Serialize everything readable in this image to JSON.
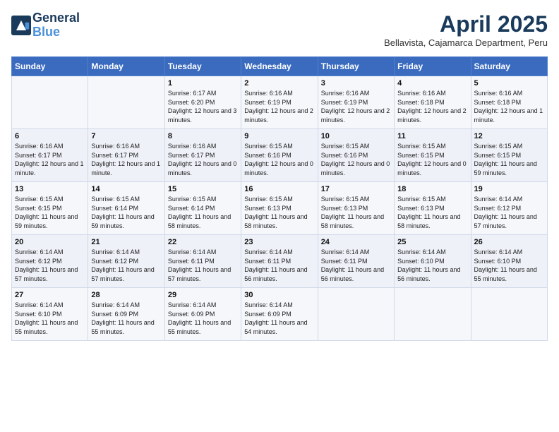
{
  "logo": {
    "line1": "General",
    "line2": "Blue"
  },
  "title": "April 2025",
  "location": "Bellavista, Cajamarca Department, Peru",
  "days_of_week": [
    "Sunday",
    "Monday",
    "Tuesday",
    "Wednesday",
    "Thursday",
    "Friday",
    "Saturday"
  ],
  "weeks": [
    [
      {
        "day": "",
        "info": ""
      },
      {
        "day": "",
        "info": ""
      },
      {
        "day": "1",
        "info": "Sunrise: 6:17 AM\nSunset: 6:20 PM\nDaylight: 12 hours and 3 minutes."
      },
      {
        "day": "2",
        "info": "Sunrise: 6:16 AM\nSunset: 6:19 PM\nDaylight: 12 hours and 2 minutes."
      },
      {
        "day": "3",
        "info": "Sunrise: 6:16 AM\nSunset: 6:19 PM\nDaylight: 12 hours and 2 minutes."
      },
      {
        "day": "4",
        "info": "Sunrise: 6:16 AM\nSunset: 6:18 PM\nDaylight: 12 hours and 2 minutes."
      },
      {
        "day": "5",
        "info": "Sunrise: 6:16 AM\nSunset: 6:18 PM\nDaylight: 12 hours and 1 minute."
      }
    ],
    [
      {
        "day": "6",
        "info": "Sunrise: 6:16 AM\nSunset: 6:17 PM\nDaylight: 12 hours and 1 minute."
      },
      {
        "day": "7",
        "info": "Sunrise: 6:16 AM\nSunset: 6:17 PM\nDaylight: 12 hours and 1 minute."
      },
      {
        "day": "8",
        "info": "Sunrise: 6:16 AM\nSunset: 6:17 PM\nDaylight: 12 hours and 0 minutes."
      },
      {
        "day": "9",
        "info": "Sunrise: 6:15 AM\nSunset: 6:16 PM\nDaylight: 12 hours and 0 minutes."
      },
      {
        "day": "10",
        "info": "Sunrise: 6:15 AM\nSunset: 6:16 PM\nDaylight: 12 hours and 0 minutes."
      },
      {
        "day": "11",
        "info": "Sunrise: 6:15 AM\nSunset: 6:15 PM\nDaylight: 12 hours and 0 minutes."
      },
      {
        "day": "12",
        "info": "Sunrise: 6:15 AM\nSunset: 6:15 PM\nDaylight: 11 hours and 59 minutes."
      }
    ],
    [
      {
        "day": "13",
        "info": "Sunrise: 6:15 AM\nSunset: 6:15 PM\nDaylight: 11 hours and 59 minutes."
      },
      {
        "day": "14",
        "info": "Sunrise: 6:15 AM\nSunset: 6:14 PM\nDaylight: 11 hours and 59 minutes."
      },
      {
        "day": "15",
        "info": "Sunrise: 6:15 AM\nSunset: 6:14 PM\nDaylight: 11 hours and 58 minutes."
      },
      {
        "day": "16",
        "info": "Sunrise: 6:15 AM\nSunset: 6:13 PM\nDaylight: 11 hours and 58 minutes."
      },
      {
        "day": "17",
        "info": "Sunrise: 6:15 AM\nSunset: 6:13 PM\nDaylight: 11 hours and 58 minutes."
      },
      {
        "day": "18",
        "info": "Sunrise: 6:15 AM\nSunset: 6:13 PM\nDaylight: 11 hours and 58 minutes."
      },
      {
        "day": "19",
        "info": "Sunrise: 6:14 AM\nSunset: 6:12 PM\nDaylight: 11 hours and 57 minutes."
      }
    ],
    [
      {
        "day": "20",
        "info": "Sunrise: 6:14 AM\nSunset: 6:12 PM\nDaylight: 11 hours and 57 minutes."
      },
      {
        "day": "21",
        "info": "Sunrise: 6:14 AM\nSunset: 6:12 PM\nDaylight: 11 hours and 57 minutes."
      },
      {
        "day": "22",
        "info": "Sunrise: 6:14 AM\nSunset: 6:11 PM\nDaylight: 11 hours and 57 minutes."
      },
      {
        "day": "23",
        "info": "Sunrise: 6:14 AM\nSunset: 6:11 PM\nDaylight: 11 hours and 56 minutes."
      },
      {
        "day": "24",
        "info": "Sunrise: 6:14 AM\nSunset: 6:11 PM\nDaylight: 11 hours and 56 minutes."
      },
      {
        "day": "25",
        "info": "Sunrise: 6:14 AM\nSunset: 6:10 PM\nDaylight: 11 hours and 56 minutes."
      },
      {
        "day": "26",
        "info": "Sunrise: 6:14 AM\nSunset: 6:10 PM\nDaylight: 11 hours and 55 minutes."
      }
    ],
    [
      {
        "day": "27",
        "info": "Sunrise: 6:14 AM\nSunset: 6:10 PM\nDaylight: 11 hours and 55 minutes."
      },
      {
        "day": "28",
        "info": "Sunrise: 6:14 AM\nSunset: 6:09 PM\nDaylight: 11 hours and 55 minutes."
      },
      {
        "day": "29",
        "info": "Sunrise: 6:14 AM\nSunset: 6:09 PM\nDaylight: 11 hours and 55 minutes."
      },
      {
        "day": "30",
        "info": "Sunrise: 6:14 AM\nSunset: 6:09 PM\nDaylight: 11 hours and 54 minutes."
      },
      {
        "day": "",
        "info": ""
      },
      {
        "day": "",
        "info": ""
      },
      {
        "day": "",
        "info": ""
      }
    ]
  ]
}
